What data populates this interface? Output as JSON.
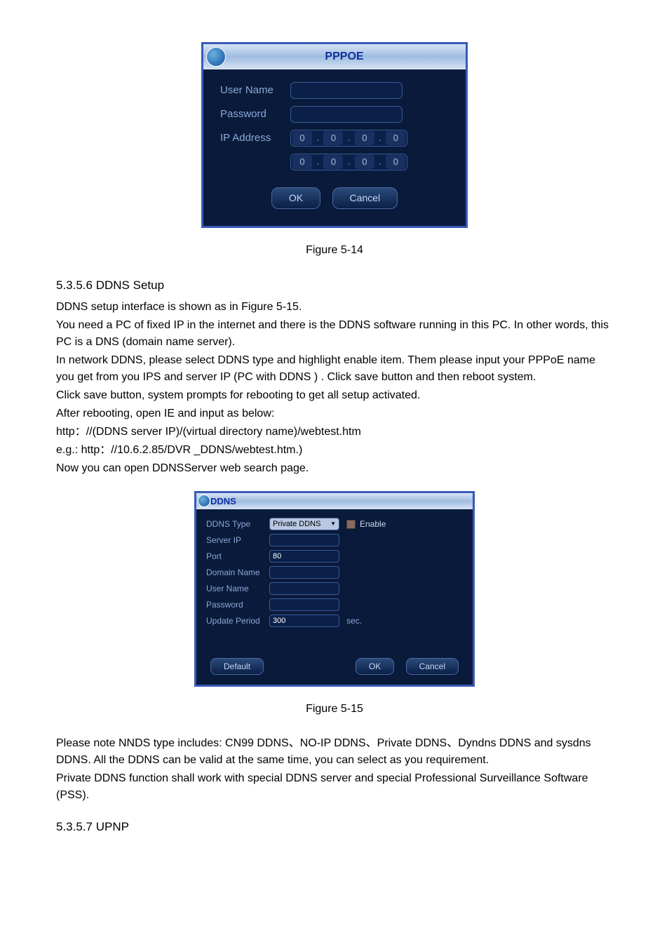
{
  "pppoe": {
    "title": "PPPOE",
    "labels": {
      "user": "User Name",
      "password": "Password",
      "ip": "IP Address"
    },
    "ip1": [
      "0",
      "0",
      "0",
      "0"
    ],
    "ip2": [
      "0",
      "0",
      "0",
      "0"
    ],
    "ok": "OK",
    "cancel": "Cancel"
  },
  "fig514": "Figure 5-14",
  "sec556": "5.3.5.6  DDNS Setup",
  "p1": "DDNS setup interface is shown as in Figure 5-15.",
  "p2": "You need a PC of fixed IP in the internet and there is the DDNS software running in this PC. In other words, this PC is a DNS (domain name server).",
  "p3": "In network DDNS, please select DDNS type and highlight enable item. Them please input your PPPoE name you get from you IPS and server IP (PC with DDNS ) . Click save button and then reboot system.",
  "p4": "Click save button, system prompts for rebooting to get all setup activated.",
  "p5": "After rebooting, open IE and input as below:",
  "p6": "http：//(DDNS server IP)/(virtual directory name)/webtest.htm",
  "p7": "e.g.: http：//10.6.2.85/DVR _DDNS/webtest.htm.)",
  "p8": "Now you can open DDNSServer web search page.",
  "ddns": {
    "title": "DDNS",
    "labels": {
      "type": "DDNS Type",
      "serverip": "Server IP",
      "port": "Port",
      "domain": "Domain Name",
      "user": "User Name",
      "password": "Password",
      "update": "Update Period"
    },
    "type_value": "Private DDNS",
    "enable": "Enable",
    "port_value": "80",
    "update_value": "300",
    "sec": "sec.",
    "default": "Default",
    "ok": "OK",
    "cancel": "Cancel"
  },
  "fig515": "Figure 5-15",
  "p9": "Please note NNDS type includes: CN99 DDNS、NO-IP DDNS、Private DDNS、Dyndns DDNS and sysdns DDNS. All the DDNS can be valid at the same time, you can select as you requirement.",
  "p10": "Private DDNS function shall work with special DDNS server and special Professional Surveillance Software (PSS).",
  "sec557": "5.3.5.7  UPNP"
}
